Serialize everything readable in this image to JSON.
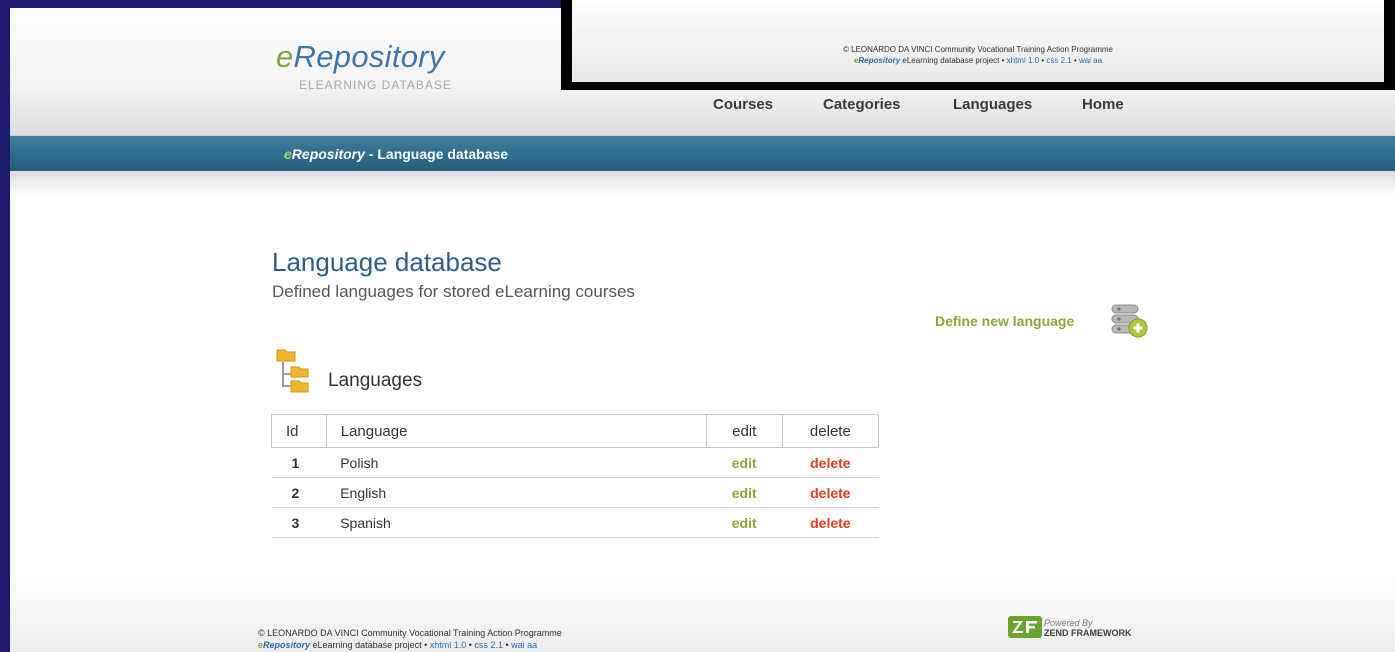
{
  "logo": {
    "e": "e",
    "name": "Repository",
    "subtitle": "ELEARNING DATABASE"
  },
  "overlay": {
    "line1": "© LEONARDO DA VINCI Community Vocational Training Action Programme",
    "brand_e": "e",
    "brand_name": "Repository",
    "line2_rest": " eLearning database project • ",
    "links": [
      "xhtml 1.0",
      "css 2.1",
      "wai aa"
    ],
    "sep": " • "
  },
  "nav": {
    "items": [
      "Courses",
      "Categories",
      "Languages",
      "Home"
    ]
  },
  "bar": {
    "brand_e": "e",
    "brand_name": "Repository",
    "title_rest": " - Language database"
  },
  "content": {
    "title": "Language database",
    "subtitle": "Defined languages for stored eLearning courses",
    "define_link": "Define new language",
    "section_heading": "Languages"
  },
  "table": {
    "headers": [
      "Id",
      "Language",
      "edit",
      "delete"
    ],
    "rows": [
      {
        "id": "1",
        "language": "Polish",
        "edit": "edit",
        "delete": "delete"
      },
      {
        "id": "2",
        "language": "English",
        "edit": "edit",
        "delete": "delete"
      },
      {
        "id": "3",
        "language": "Spanish",
        "edit": "edit",
        "delete": "delete"
      }
    ]
  },
  "footer": {
    "line1": "© LEONARDO DA VINCI Community Vocational Training Action Programme",
    "brand_e": "e",
    "brand_name": "Repository",
    "line2_rest": " eLearning database project • ",
    "links": [
      "xhtml 1.0",
      "css 2.1",
      "wai aa"
    ],
    "sep": " • ",
    "powered_by": "Powered By",
    "framework": "ZEND FRAMEWORK"
  },
  "colors": {
    "accent_blue": "#2b5f86",
    "bar_teal": "#2f6d8b",
    "link_green": "#8aa838",
    "delete_red": "#e0401c",
    "frame_navy": "#1d1a6e"
  },
  "icons": {
    "database_add": "database-add-icon",
    "folder_tree": "folder-tree-icon",
    "zend_logo": "zend-framework-logo"
  }
}
